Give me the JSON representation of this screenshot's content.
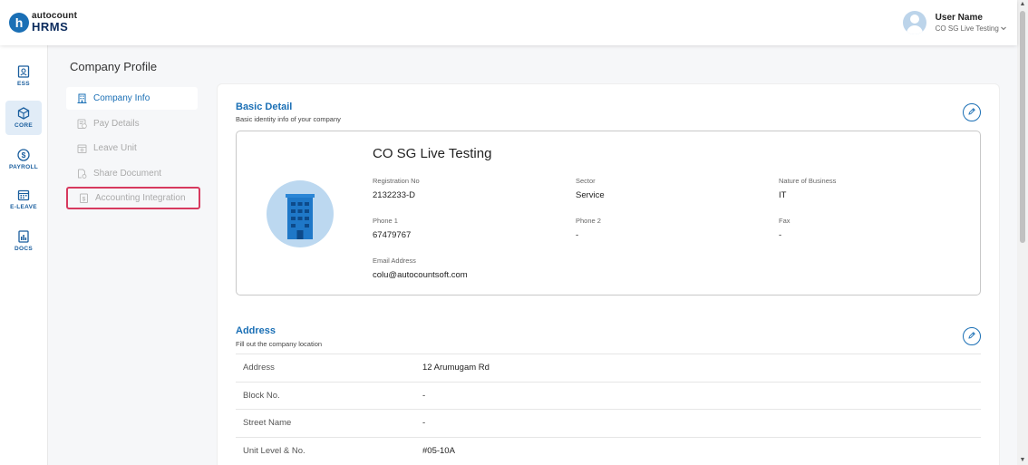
{
  "app": {
    "logo_small": "autocount",
    "logo_big": "HRMS",
    "logo_letter": "h"
  },
  "user": {
    "name": "User Name",
    "company": "CO SG Live Testing",
    "dropdown_icon": "chevron-down-icon"
  },
  "nav": [
    {
      "label": "ESS",
      "icon": "id-card-icon",
      "active": false
    },
    {
      "label": "CORE",
      "icon": "cube-icon",
      "active": true
    },
    {
      "label": "PAYROLL",
      "icon": "dollar-icon",
      "active": false
    },
    {
      "label": "E-LEAVE",
      "icon": "calendar-icon",
      "active": false
    },
    {
      "label": "DOCS",
      "icon": "document-icon",
      "active": false
    }
  ],
  "page": {
    "title": "Company Profile"
  },
  "submenu": [
    {
      "label": "Company Info",
      "icon": "building-icon"
    },
    {
      "label": "Pay Details",
      "icon": "pay-icon"
    },
    {
      "label": "Leave Unit",
      "icon": "calendar-icon"
    },
    {
      "label": "Share Document",
      "icon": "share-doc-icon"
    },
    {
      "label": "Accounting Integration",
      "icon": "dollar-doc-icon"
    }
  ],
  "basic": {
    "title": "Basic Detail",
    "subtitle": "Basic identity info of your company",
    "company_name": "CO SG Live Testing",
    "fields": [
      {
        "label": "Registration No",
        "value": "2132233-D"
      },
      {
        "label": "Sector",
        "value": "Service"
      },
      {
        "label": "Nature of Business",
        "value": "IT"
      },
      {
        "label": "Phone 1",
        "value": "67479767"
      },
      {
        "label": "Phone 2",
        "value": "-"
      },
      {
        "label": "Fax",
        "value": "-"
      },
      {
        "label": "Email Address",
        "value": "colu@autocountsoft.com"
      }
    ]
  },
  "address": {
    "title": "Address",
    "subtitle": "Fill out the company location",
    "rows": [
      {
        "label": "Address",
        "value": "12 Arumugam Rd"
      },
      {
        "label": "Block No.",
        "value": "-"
      },
      {
        "label": "Street Name",
        "value": "-"
      },
      {
        "label": "Unit Level & No.",
        "value": "#05-10A"
      }
    ]
  },
  "colors": {
    "accent": "#1a6fb5",
    "highlight_border": "#d73a5f"
  }
}
